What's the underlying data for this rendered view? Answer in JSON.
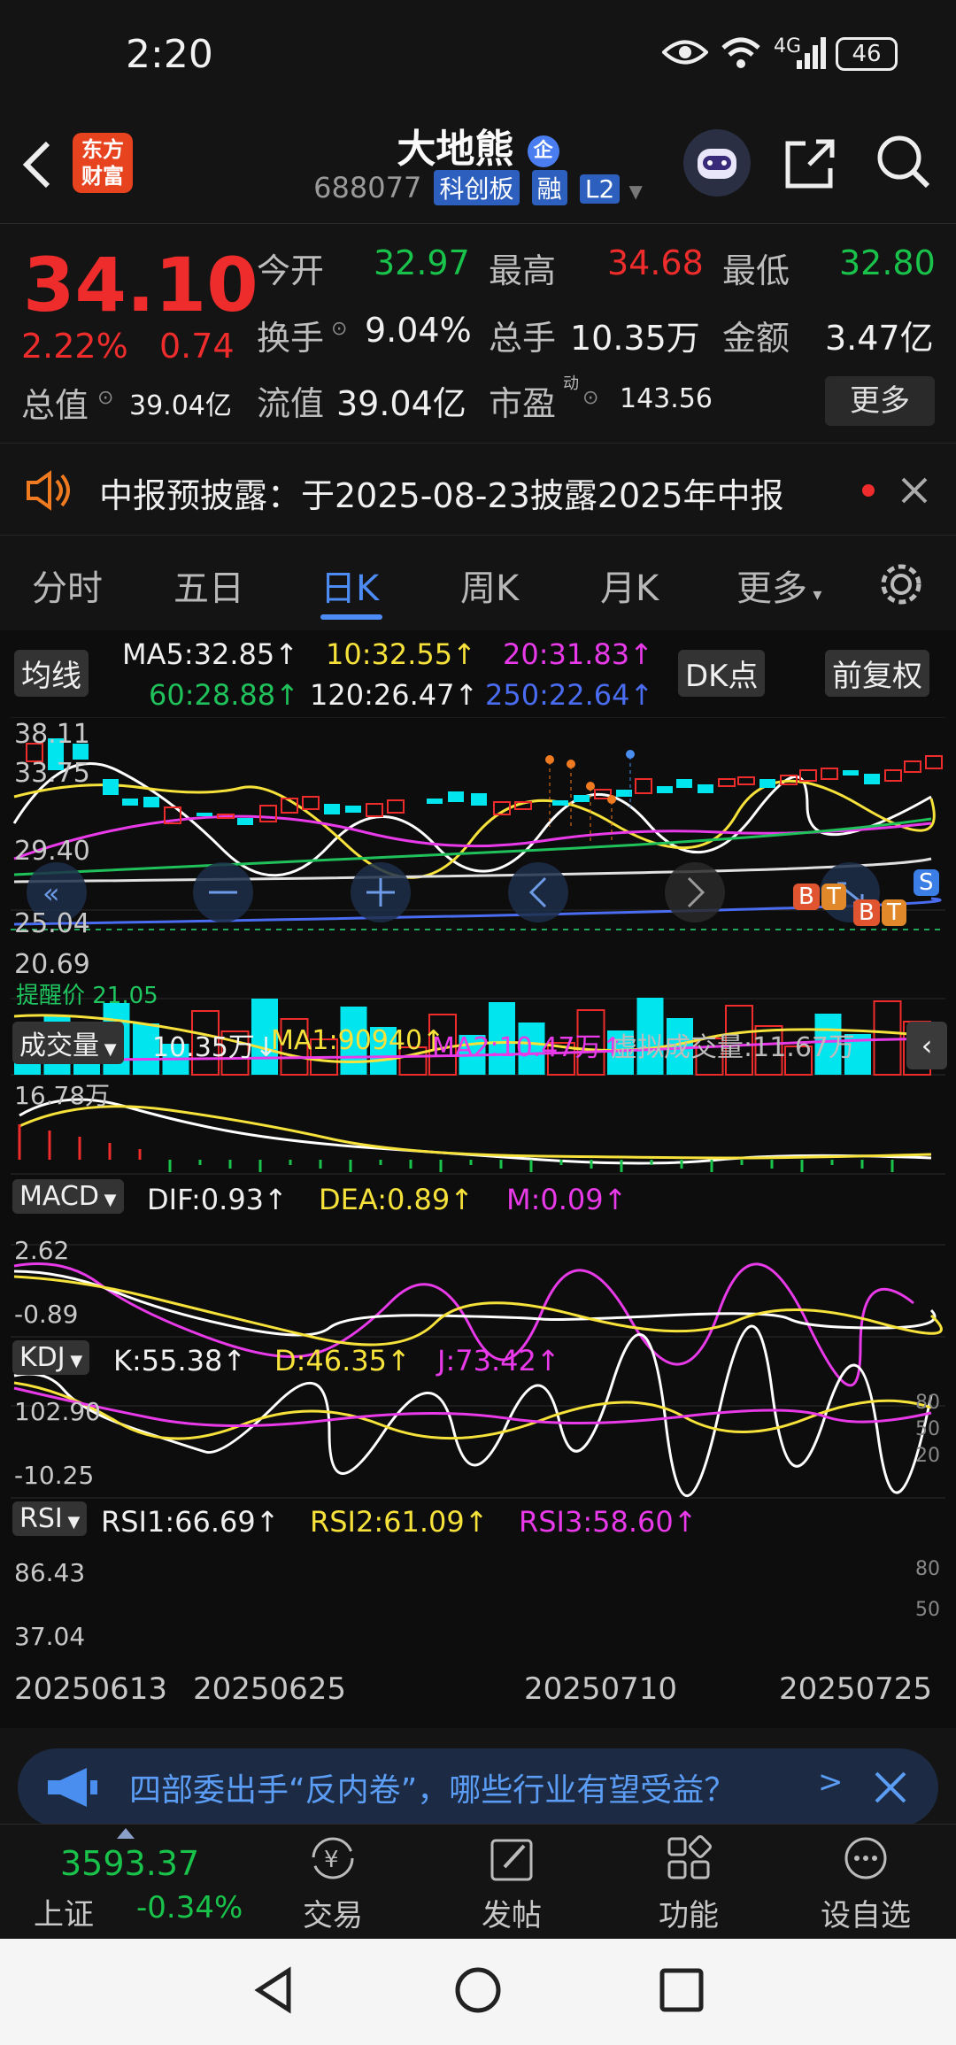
{
  "status_bar": {
    "time": "2:20",
    "battery": "46",
    "network": "4G"
  },
  "header": {
    "logo_line1": "东方",
    "logo_line2": "财富",
    "title": "大地熊",
    "title_badge": "企",
    "code": "688077",
    "tags": [
      "科创板",
      "融",
      "L2"
    ]
  },
  "quote": {
    "price": "34.10",
    "change_pct": "2.22%",
    "change": "0.74",
    "total_value_label": "总值",
    "total_value": "39.04亿",
    "open_label": "今开",
    "open": "32.97",
    "high_label": "最高",
    "high": "34.68",
    "low_label": "最低",
    "low": "32.80",
    "turnover_label": "换手",
    "turnover": "9.04%",
    "volume_label": "总手",
    "volume": "10.35万",
    "amount_label": "金额",
    "amount": "3.47亿",
    "float_label": "流值",
    "float_value": "39.04亿",
    "pe_label": "市盈",
    "pe_sup": "动",
    "pe": "143.56",
    "more_label": "更多"
  },
  "notice": {
    "text": "中报预披露：于2025-08-23披露2025年中报"
  },
  "tabs": [
    "分时",
    "五日",
    "日K",
    "周K",
    "月K",
    "更多"
  ],
  "active_tab": 2,
  "kline": {
    "ma_button": "均线",
    "ma5": "MA5:32.85↑",
    "ma10": "10:32.55↑",
    "ma20": "20:31.83↑",
    "ma60": "60:28.88↑",
    "ma120": "120:26.47↑",
    "ma250": "250:22.64↑",
    "dk_button": "DK点",
    "adjust_button": "前复权",
    "y_labels": [
      "38.11",
      "33.75",
      "29.40",
      "25.04",
      "20.69"
    ],
    "alert_price": "提醒价 21.05",
    "markers": [
      "B",
      "T",
      "B",
      "T",
      "S"
    ]
  },
  "volume": {
    "button": "成交量",
    "vol": "10.35万↓",
    "ma1": "MA1:90940↑",
    "ma2": "MA2:10.47万↑",
    "virtual": "虚拟成交量:11.67万",
    "y_label": "16.78万"
  },
  "macd": {
    "button": "MACD",
    "dif": "DIF:0.93↑",
    "dea": "DEA:0.89↑",
    "m": "M:0.09↑",
    "y_top": "2.62",
    "y_bottom": "-0.89"
  },
  "kdj": {
    "button": "KDJ",
    "k": "K:55.38↑",
    "d": "D:46.35↑",
    "j": "J:73.42↑",
    "y_top": "102.90",
    "y_bottom": "-10.25",
    "r_levels": [
      "80",
      "50",
      "20"
    ]
  },
  "rsi": {
    "button": "RSI",
    "rsi1": "RSI1:66.69↑",
    "rsi2": "RSI2:61.09↑",
    "rsi3": "RSI3:58.60↑",
    "y_top": "86.43",
    "y_bottom": "37.04",
    "r_levels": [
      "80",
      "50"
    ]
  },
  "dates": [
    "20250613",
    "20250625",
    "20250710",
    "20250725"
  ],
  "banner": {
    "text": "四部委出手“反内卷”，哪些行业有望受益？"
  },
  "bottom_bar": {
    "index_value": "3593.37",
    "index_name": "上证",
    "index_change": "-0.34%",
    "items": [
      "交易",
      "发帖",
      "功能",
      "设自选"
    ]
  },
  "colors": {
    "up": "#ee2c2c",
    "down": "#19c24a",
    "accent": "#4d8cf5",
    "cyan": "#00e5ee"
  }
}
